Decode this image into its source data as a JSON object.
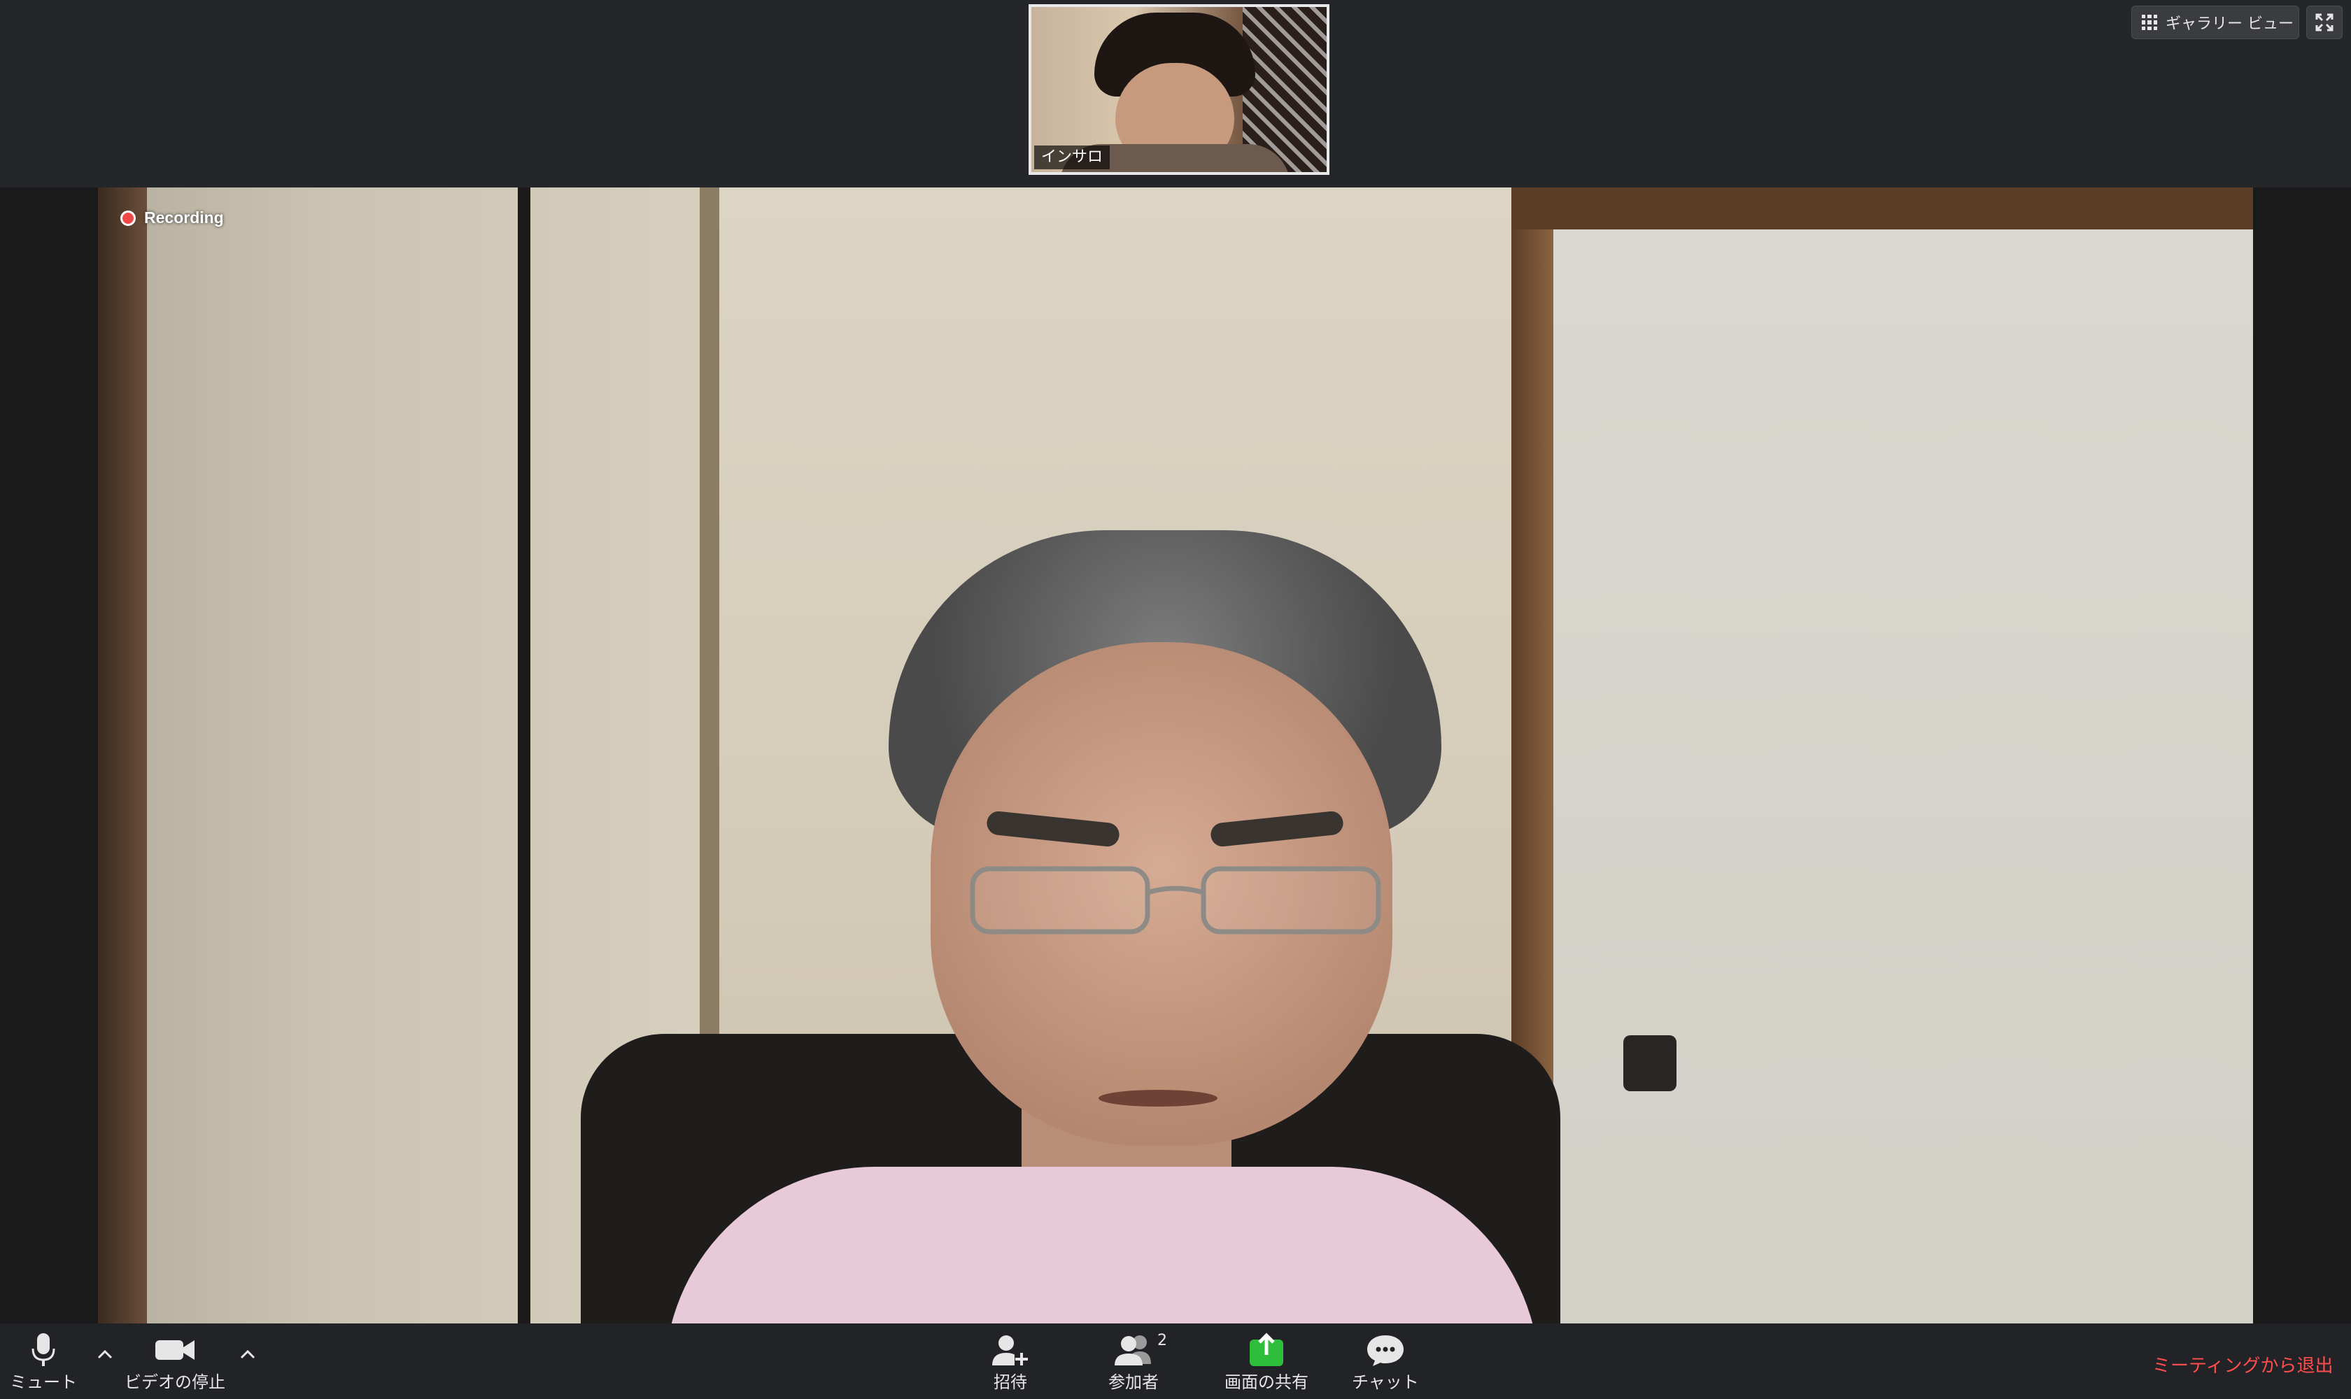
{
  "thumbnail": {
    "participant_name": "インサロ"
  },
  "top_controls": {
    "gallery_view_label": "ギャラリー ビュー"
  },
  "main_video": {
    "recording_label": "Recording"
  },
  "toolbar": {
    "mute_label": "ミュート",
    "stop_video_label": "ビデオの停止",
    "invite_label": "招待",
    "participants_label": "参加者",
    "participants_count": "2",
    "share_screen_label": "画面の共有",
    "chat_label": "チャット",
    "leave_label": "ミーティングから退出"
  },
  "colors": {
    "toolbar_bg": "#222327",
    "leave_text": "#ff4d4d",
    "share_green": "#2fbe3b",
    "recording_dot": "#f04848"
  },
  "icons": {
    "mute": "microphone-icon",
    "video": "video-camera-icon",
    "invite": "add-user-icon",
    "participants": "participants-icon",
    "share": "share-screen-icon",
    "chat": "chat-bubble-icon",
    "gallery": "grid-icon",
    "fullscreen": "fullscreen-icon"
  }
}
